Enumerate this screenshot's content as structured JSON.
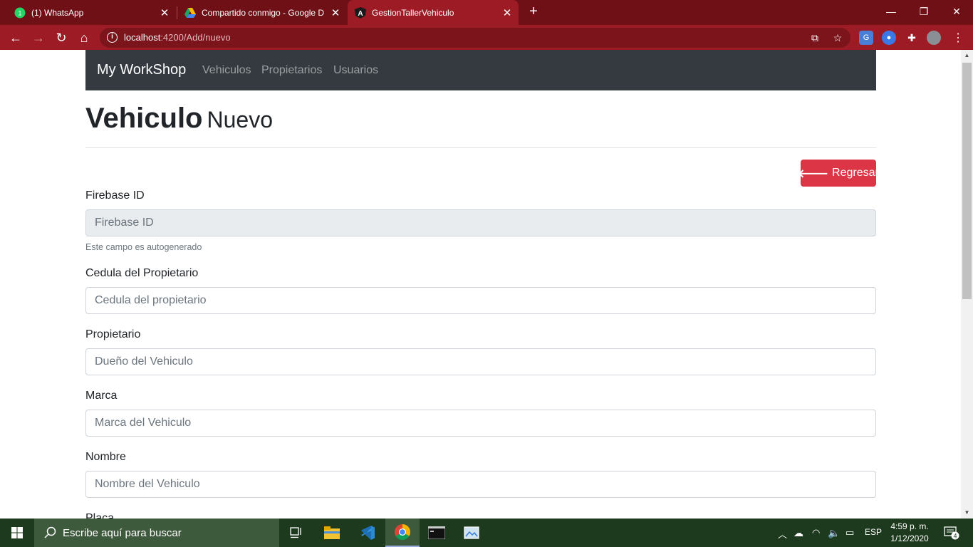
{
  "browser": {
    "tabs": [
      {
        "title": "(1) WhatsApp",
        "active": false
      },
      {
        "title": "Compartido conmigo - Google D",
        "active": false
      },
      {
        "title": "GestionTallerVehiculo",
        "active": true
      }
    ],
    "whatsapp_badge": "1",
    "angular_glyph": "A",
    "url_host": "localhost",
    "url_rest": ":4200/Add/nuevo"
  },
  "app": {
    "brand": "My WorkShop",
    "nav": [
      "Vehiculos",
      "Propietarios",
      "Usuarios"
    ],
    "heading": "Vehiculo",
    "subheading": "Nuevo",
    "back_button": "Regresar"
  },
  "form": {
    "firebase": {
      "label": "Firebase ID",
      "placeholder": "Firebase ID",
      "help": "Este campo es autogenerado"
    },
    "cedula": {
      "label": "Cedula del Propietario",
      "placeholder": "Cedula del propietario"
    },
    "propietario": {
      "label": "Propietario",
      "placeholder": "Dueño del Vehiculo"
    },
    "marca": {
      "label": "Marca",
      "placeholder": "Marca del Vehiculo"
    },
    "nombre": {
      "label": "Nombre",
      "placeholder": "Nombre del Vehiculo"
    },
    "placa": {
      "label": "Placa"
    }
  },
  "taskbar": {
    "search_placeholder": "Escribe aquí para buscar",
    "language": "ESP",
    "time": "4:59 p. m.",
    "date": "1/12/2020",
    "notifications": "4"
  },
  "colors": {
    "tabstrip": "#6e1016",
    "toolbar": "#9d1b24",
    "navbar": "#343a40",
    "danger": "#dc3545",
    "taskbar": "#1e3a1e"
  }
}
